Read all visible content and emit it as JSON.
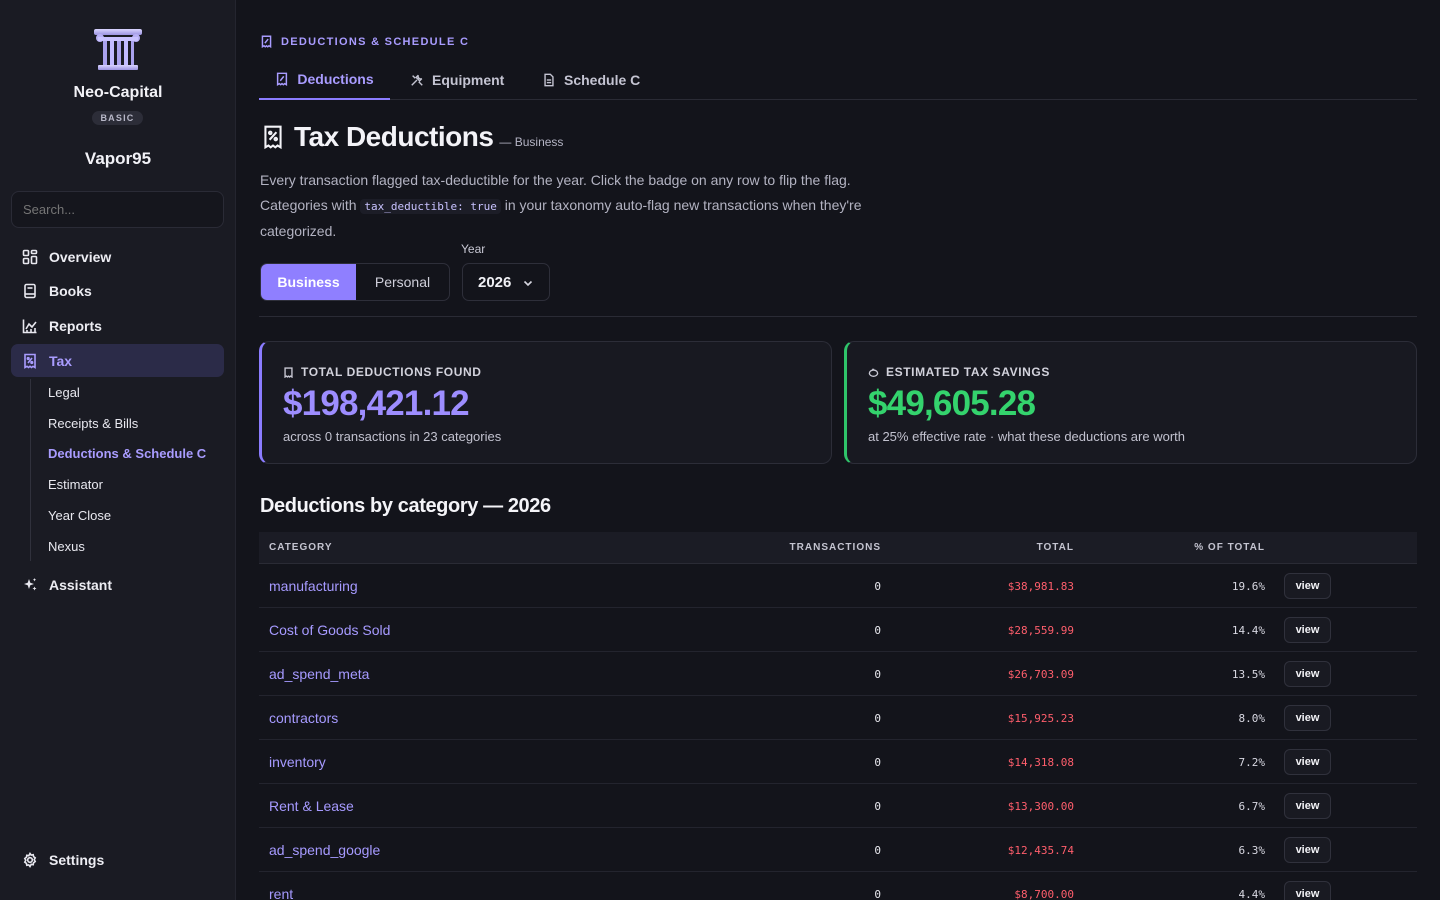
{
  "sidebar": {
    "org_name": "Neo-Capital",
    "plan": "BASIC",
    "user": "Vapor95",
    "search_placeholder": "Search...",
    "nav": [
      {
        "label": "Overview",
        "icon": "grid-icon"
      },
      {
        "label": "Books",
        "icon": "book-icon"
      },
      {
        "label": "Reports",
        "icon": "chart-icon"
      },
      {
        "label": "Tax",
        "icon": "receipt-icon",
        "active": true
      }
    ],
    "sub_nav": [
      "Legal",
      "Receipts & Bills",
      "Deductions & Schedule C",
      "Estimator",
      "Year Close",
      "Nexus"
    ],
    "sub_nav_active": "Deductions & Schedule C",
    "assistant": "Assistant",
    "settings": "Settings"
  },
  "header": {
    "kicker": "DEDUCTIONS & SCHEDULE C",
    "tabs": [
      {
        "label": "Deductions",
        "icon": "receipt-icon",
        "active": true
      },
      {
        "label": "Equipment",
        "icon": "tools-icon"
      },
      {
        "label": "Schedule C",
        "icon": "document-icon"
      }
    ]
  },
  "page": {
    "title": "Tax Deductions",
    "title_suffix": "— Business",
    "desc_part1": "Every transaction flagged tax-deductible for the year. Click the badge on any row to flip the flag. Categories with",
    "desc_code": "tax_deductible: true",
    "desc_part2": "in your taxonomy auto-flag new transactions when they're categorized.",
    "year_label": "Year",
    "scope_options": [
      "Business",
      "Personal"
    ],
    "scope_selected": "Business",
    "year_value": "2026"
  },
  "cards": {
    "deductions": {
      "label": "TOTAL DEDUCTIONS FOUND",
      "value": "$198,421.12",
      "note": "across 0 transactions in 23 categories"
    },
    "savings": {
      "label": "ESTIMATED TAX SAVINGS",
      "value": "$49,605.28",
      "note": "at 25% effective rate · what these deductions are worth"
    }
  },
  "table": {
    "title": "Deductions by category — 2026",
    "headers": {
      "category": "CATEGORY",
      "transactions": "TRANSACTIONS",
      "total": "TOTAL",
      "pct": "% OF TOTAL"
    },
    "view_label": "view",
    "rows": [
      {
        "category": "manufacturing",
        "transactions": "0",
        "total": "$38,981.83",
        "pct": "19.6%"
      },
      {
        "category": "Cost of Goods Sold",
        "transactions": "0",
        "total": "$28,559.99",
        "pct": "14.4%"
      },
      {
        "category": "ad_spend_meta",
        "transactions": "0",
        "total": "$26,703.09",
        "pct": "13.5%"
      },
      {
        "category": "contractors",
        "transactions": "0",
        "total": "$15,925.23",
        "pct": "8.0%"
      },
      {
        "category": "inventory",
        "transactions": "0",
        "total": "$14,318.08",
        "pct": "7.2%"
      },
      {
        "category": "Rent & Lease",
        "transactions": "0",
        "total": "$13,300.00",
        "pct": "6.7%"
      },
      {
        "category": "ad_spend_google",
        "transactions": "0",
        "total": "$12,435.74",
        "pct": "6.3%"
      },
      {
        "category": "rent",
        "transactions": "0",
        "total": "$8,700.00",
        "pct": "4.4%"
      }
    ]
  },
  "colors": {
    "accent": "#8b7cff",
    "positive": "#34d36d",
    "negative": "#ff5e6c",
    "background": "#13141b",
    "sidebar": "#1a1b23"
  }
}
